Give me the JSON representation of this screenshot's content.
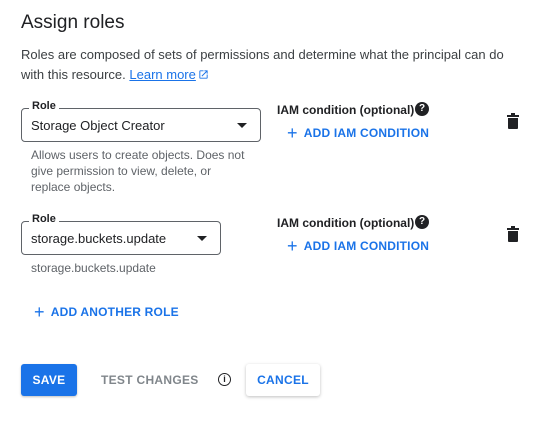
{
  "title": "Assign roles",
  "description": {
    "text": "Roles are composed of sets of permissions and determine what the principal can do with this resource.",
    "learn_more": "Learn more"
  },
  "roles": [
    {
      "legend": "Role",
      "value": "Storage Object Creator",
      "hint": "Allows users to create objects. Does not give permission to view, delete, or replace objects.",
      "condition_label": "IAM condition (optional)",
      "add_condition": "ADD IAM CONDITION"
    },
    {
      "legend": "Role",
      "value": "storage.buckets.update",
      "hint": "storage.buckets.update",
      "condition_label": "IAM condition (optional)",
      "add_condition": "ADD IAM CONDITION"
    }
  ],
  "add_another_role": "ADD ANOTHER ROLE",
  "buttons": {
    "save": "SAVE",
    "test_changes": "TEST CHANGES",
    "cancel": "CANCEL"
  },
  "icons": {
    "help": "help-icon",
    "delete": "trash-icon",
    "info": "info-icon",
    "external": "external-link-icon"
  },
  "colors": {
    "accent": "#1a73e8",
    "text": "#202124",
    "muted": "#5f6368"
  }
}
